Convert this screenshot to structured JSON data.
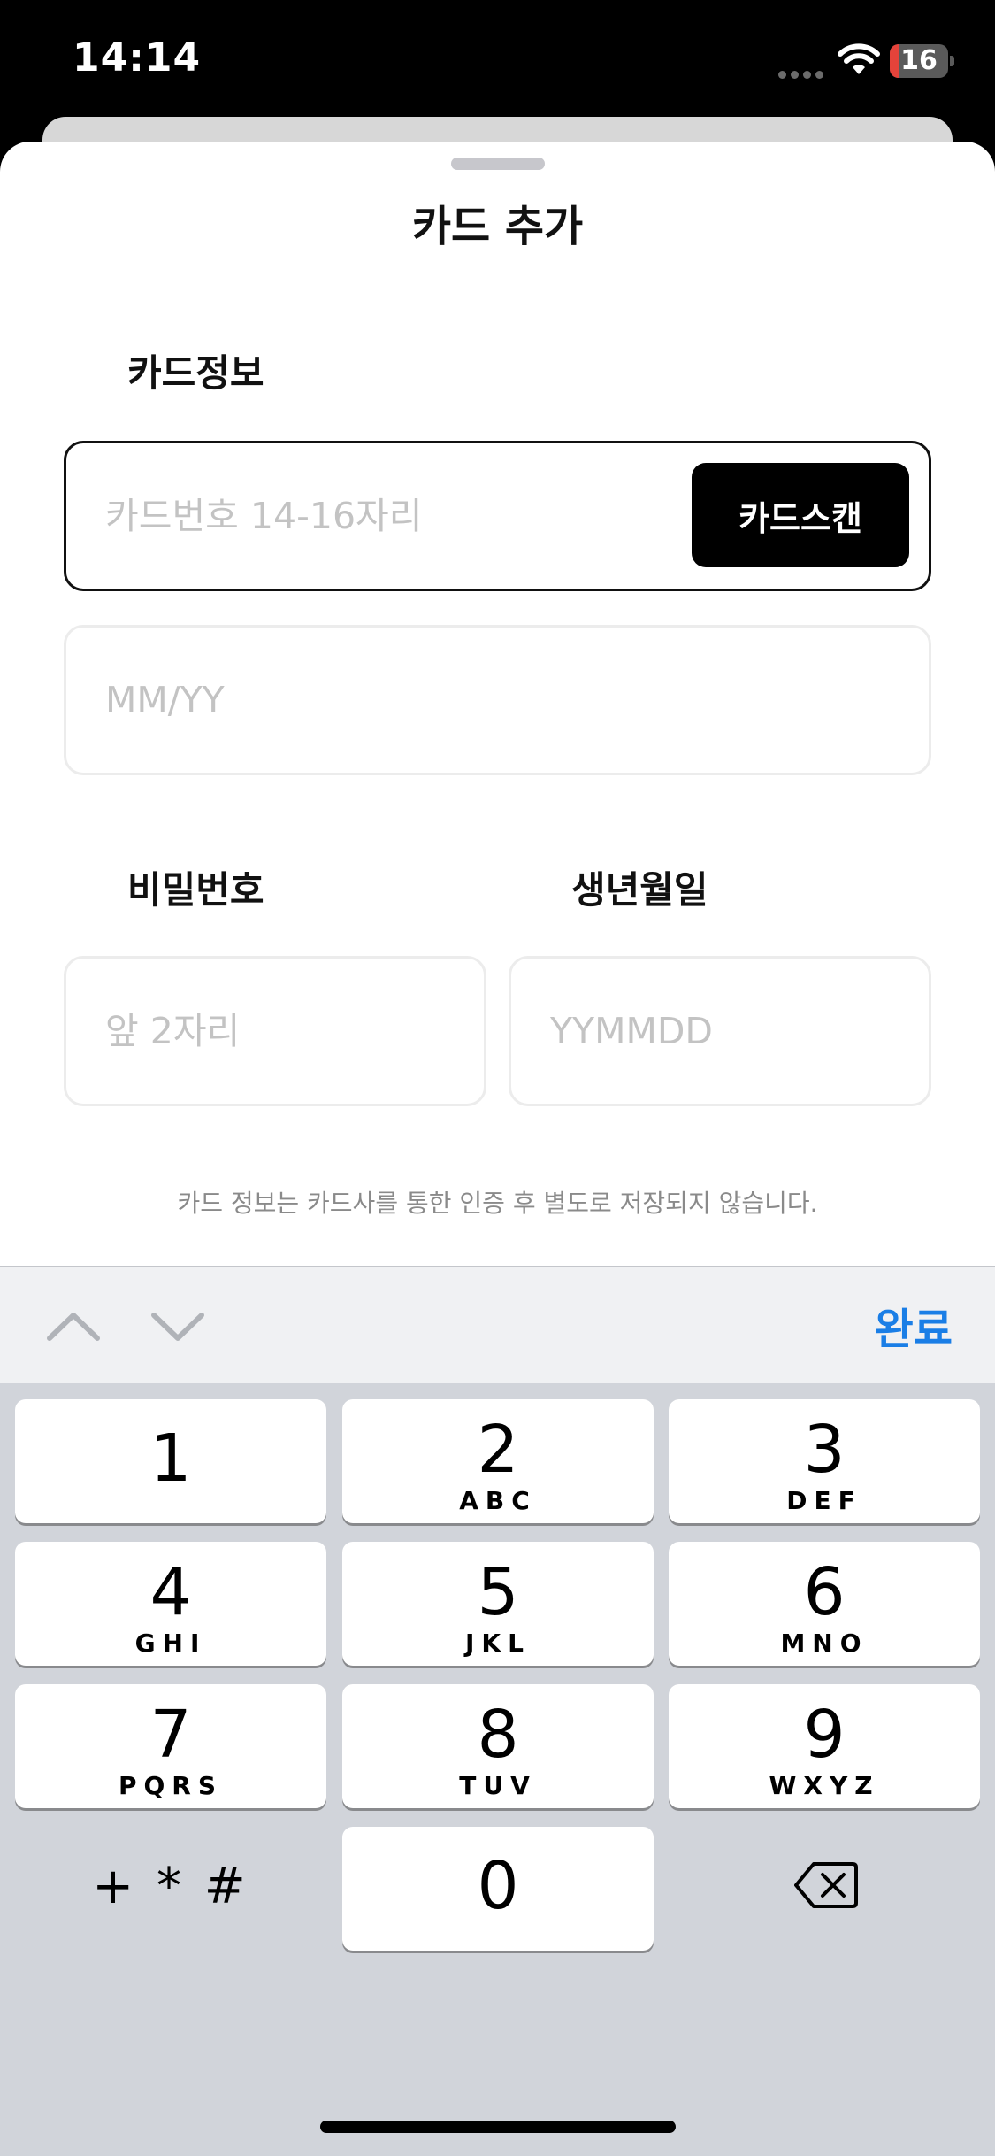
{
  "status_bar": {
    "time": "14:14",
    "battery_level": "16",
    "battery_fraction": 0.16
  },
  "sheet": {
    "title": "카드 추가",
    "card_info_label": "카드정보",
    "card_number": {
      "value": "",
      "placeholder": "카드번호 14-16자리"
    },
    "scan_button_label": "카드스캔",
    "expiry": {
      "value": "",
      "placeholder": "MM/YY"
    },
    "password_label": "비밀번호",
    "password": {
      "value": "",
      "placeholder": "앞 2자리"
    },
    "birth_label": "생년월일",
    "birth": {
      "value": "",
      "placeholder": "YYMMDD"
    },
    "notice": "카드 정보는 카드사를 통한 인증 후 별도로 저장되지 않습니다."
  },
  "accessory_bar": {
    "done_label": "완료",
    "accent_color": "#1a7ee6"
  },
  "keypad": {
    "keys": [
      {
        "digit": "1",
        "letters": ""
      },
      {
        "digit": "2",
        "letters": "ABC"
      },
      {
        "digit": "3",
        "letters": "DEF"
      },
      {
        "digit": "4",
        "letters": "GHI"
      },
      {
        "digit": "5",
        "letters": "JKL"
      },
      {
        "digit": "6",
        "letters": "MNO"
      },
      {
        "digit": "7",
        "letters": "PQRS"
      },
      {
        "digit": "8",
        "letters": "TUV"
      },
      {
        "digit": "9",
        "letters": "WXYZ"
      },
      {
        "digit": "0",
        "letters": ""
      }
    ],
    "symbols_label": "+ * #"
  },
  "icons": [
    "wifi-icon",
    "battery-icon",
    "chevron-up-icon",
    "chevron-down-icon",
    "delete-icon"
  ]
}
